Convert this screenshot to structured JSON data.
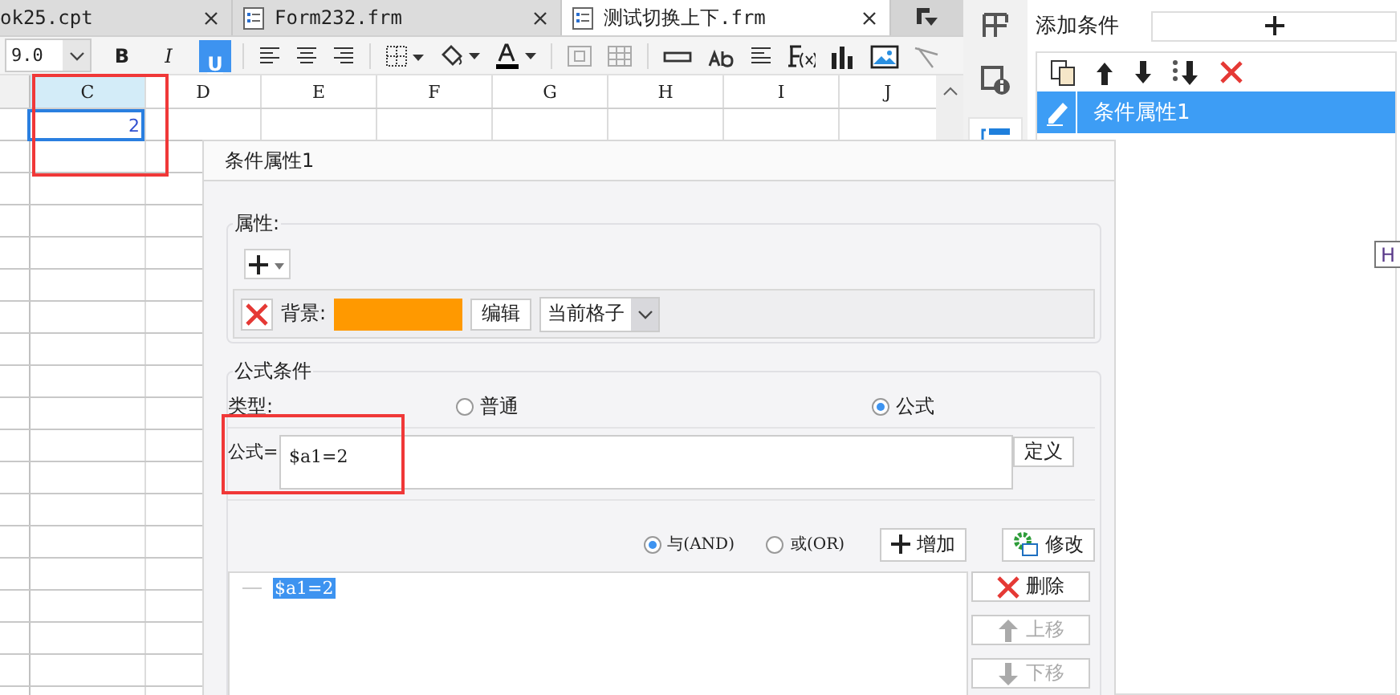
{
  "tabs": [
    {
      "label": "ok25.cpt",
      "selected": false
    },
    {
      "label": "Form232.frm",
      "selected": false
    },
    {
      "label": "测试切换上下.frm",
      "selected": true
    }
  ],
  "toolbar": {
    "font_size": "9.0",
    "format_buttons": [
      {
        "label": "B",
        "on": false
      },
      {
        "label": "I",
        "on": false
      },
      {
        "label": "U",
        "on": true
      }
    ]
  },
  "sheet": {
    "columns": [
      {
        "label": "C",
        "selected": true
      },
      {
        "label": "D",
        "selected": false
      },
      {
        "label": "E",
        "selected": false
      },
      {
        "label": "F",
        "selected": false
      },
      {
        "label": "G",
        "selected": false
      },
      {
        "label": "H",
        "selected": false
      },
      {
        "label": "I",
        "selected": false
      },
      {
        "label": "J",
        "selected": false
      }
    ],
    "active_cell": {
      "value": "2"
    }
  },
  "dialog": {
    "title": "条件属性1",
    "property_section": {
      "legend": "属性:",
      "row_label": "背景:",
      "edit_button": "编辑",
      "scope": "当前格子"
    },
    "formula_section": {
      "legend": "公式条件",
      "type_label": "类型:",
      "types": [
        {
          "label": "普通",
          "selected": false
        },
        {
          "label": "公式",
          "selected": true
        }
      ],
      "formula_label": "公式=",
      "formula": "$a1=2",
      "define_button": "定义",
      "joins": [
        {
          "label": "与(AND)",
          "selected": true
        },
        {
          "label": "或(OR)",
          "selected": false
        }
      ],
      "add_button": "增加",
      "modify_button": "修改",
      "conditions": [
        {
          "text": "$a1=2",
          "selected": true
        }
      ],
      "side_buttons": [
        {
          "label": "删除",
          "kind": "delete",
          "disabled": false
        },
        {
          "label": "上移",
          "kind": "up",
          "disabled": true
        },
        {
          "label": "下移",
          "kind": "down",
          "disabled": true
        }
      ]
    }
  },
  "side_icons": [
    {
      "kind": "layout",
      "selected": false
    },
    {
      "kind": "info",
      "selected": false
    },
    {
      "kind": "condition",
      "selected": true
    }
  ],
  "panel": {
    "add_label": "添加条件",
    "conditions": [
      {
        "label": "条件属性1",
        "selected": true
      }
    ],
    "tooltip": "H"
  }
}
